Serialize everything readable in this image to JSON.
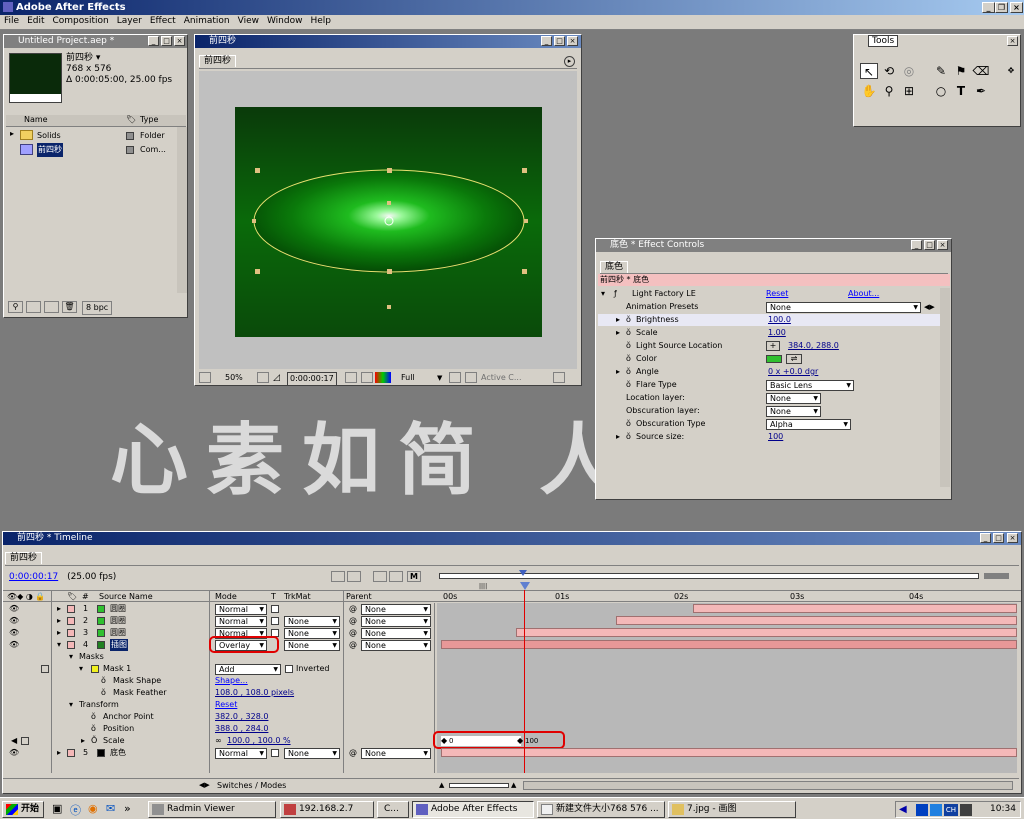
{
  "app": {
    "title": "Adobe After Effects",
    "menu": [
      "File",
      "Edit",
      "Composition",
      "Layer",
      "Effect",
      "Animation",
      "View",
      "Window",
      "Help"
    ]
  },
  "project": {
    "title": "Untitled Project.aep *",
    "comp_name": "前四秒 ▾",
    "comp_size": "768 x 576",
    "comp_dur": "Δ 0:00:05:00, 25.00 fps",
    "col_name": "Name",
    "col_type": "Type",
    "items": [
      {
        "name": "Solids",
        "type": "Folder",
        "color": "#f0d060"
      },
      {
        "name": "前四秒",
        "type": "Com...",
        "color": "#a0a0ff"
      }
    ],
    "bpc": "8 bpc"
  },
  "comp": {
    "title": "前四秒",
    "tab": "前四秒",
    "zoom": "50%",
    "time": "0:00:00:17",
    "res": "Full",
    "view": "Active C..."
  },
  "tools": {
    "title": "Tools"
  },
  "effect": {
    "title": "底色 * Effect Controls",
    "tab": "底色",
    "breadcrumb": "前四秒 * 底色",
    "name": "Light Factory LE",
    "reset": "Reset",
    "about": "About...",
    "rows": [
      {
        "label": "Animation Presets",
        "value": "None",
        "kind": "dd"
      },
      {
        "label": "Brightness",
        "value": "100.0",
        "kind": "val"
      },
      {
        "label": "Scale",
        "value": "1.00",
        "kind": "val"
      },
      {
        "label": "Light Source Location",
        "value": "384.0, 288.0",
        "kind": "point"
      },
      {
        "label": "Color",
        "value": "",
        "kind": "color"
      },
      {
        "label": "Angle",
        "value": "0 x +0.0 dgr",
        "kind": "angle"
      },
      {
        "label": "Flare Type",
        "value": "Basic Lens",
        "kind": "dd"
      },
      {
        "label": "Location layer:",
        "value": "None",
        "kind": "dd"
      },
      {
        "label": "Obscuration layer:",
        "value": "None",
        "kind": "dd"
      },
      {
        "label": "Obscuration Type",
        "value": "Alpha",
        "kind": "dd"
      },
      {
        "label": "Source size:",
        "value": "100",
        "kind": "val"
      }
    ],
    "flare_color": "#30c030"
  },
  "watermark": "心素如简 人淡如菊",
  "timeline": {
    "title": "前四秒 * Timeline",
    "tab": "前四秒",
    "time": "0:00:00:17",
    "fps": "(25.00 fps)",
    "headers": {
      "num": "#",
      "source": "Source Name",
      "mode": "Mode",
      "t": "T",
      "trkmat": "TrkMat",
      "parent": "Parent"
    },
    "ruler": [
      "00s",
      "01s",
      "02s",
      "03s",
      "04s"
    ],
    "layers": [
      {
        "num": "1",
        "name": "圆圈",
        "mode": "Normal",
        "trk": "",
        "parent": "None",
        "color": "#30c030"
      },
      {
        "num": "2",
        "name": "圆圈",
        "mode": "Normal",
        "trk": "None",
        "parent": "None",
        "color": "#30c030"
      },
      {
        "num": "3",
        "name": "圆圈",
        "mode": "Normal",
        "trk": "None",
        "parent": "None",
        "color": "#30c030"
      },
      {
        "num": "4",
        "name": "插图",
        "mode": "Overlay",
        "trk": "None",
        "parent": "None",
        "color": "#208020"
      }
    ],
    "masks": "Masks",
    "mask1": "Mask 1",
    "mask_mode": "Add",
    "inverted": "Inverted",
    "mask_shape": "Mask Shape",
    "mask_shape_val": "Shape...",
    "mask_feather": "Mask Feather",
    "mask_feather_val": "108.0 , 108.0 pixels",
    "transform": "Transform",
    "transform_reset": "Reset",
    "anchor": "Anchor Point",
    "anchor_val": "382.0 , 328.0",
    "position": "Position",
    "position_val": "388.0 , 284.0",
    "scale": "Scale",
    "scale_val": "100.0 , 100.0 %",
    "kf1": "0",
    "kf2": "100",
    "layer5": {
      "num": "5",
      "name": "底色",
      "mode": "Normal",
      "trk": "None",
      "parent": "None",
      "color": "#000000"
    },
    "switches": "Switches / Modes"
  },
  "taskbar": {
    "start": "开始",
    "items": [
      "Radmin Viewer",
      "192.168.2.7",
      "C...",
      "Adobe After Effects",
      "新建文件大小768 576 ...",
      "7.jpg - 画图"
    ],
    "clock": "10:34"
  }
}
